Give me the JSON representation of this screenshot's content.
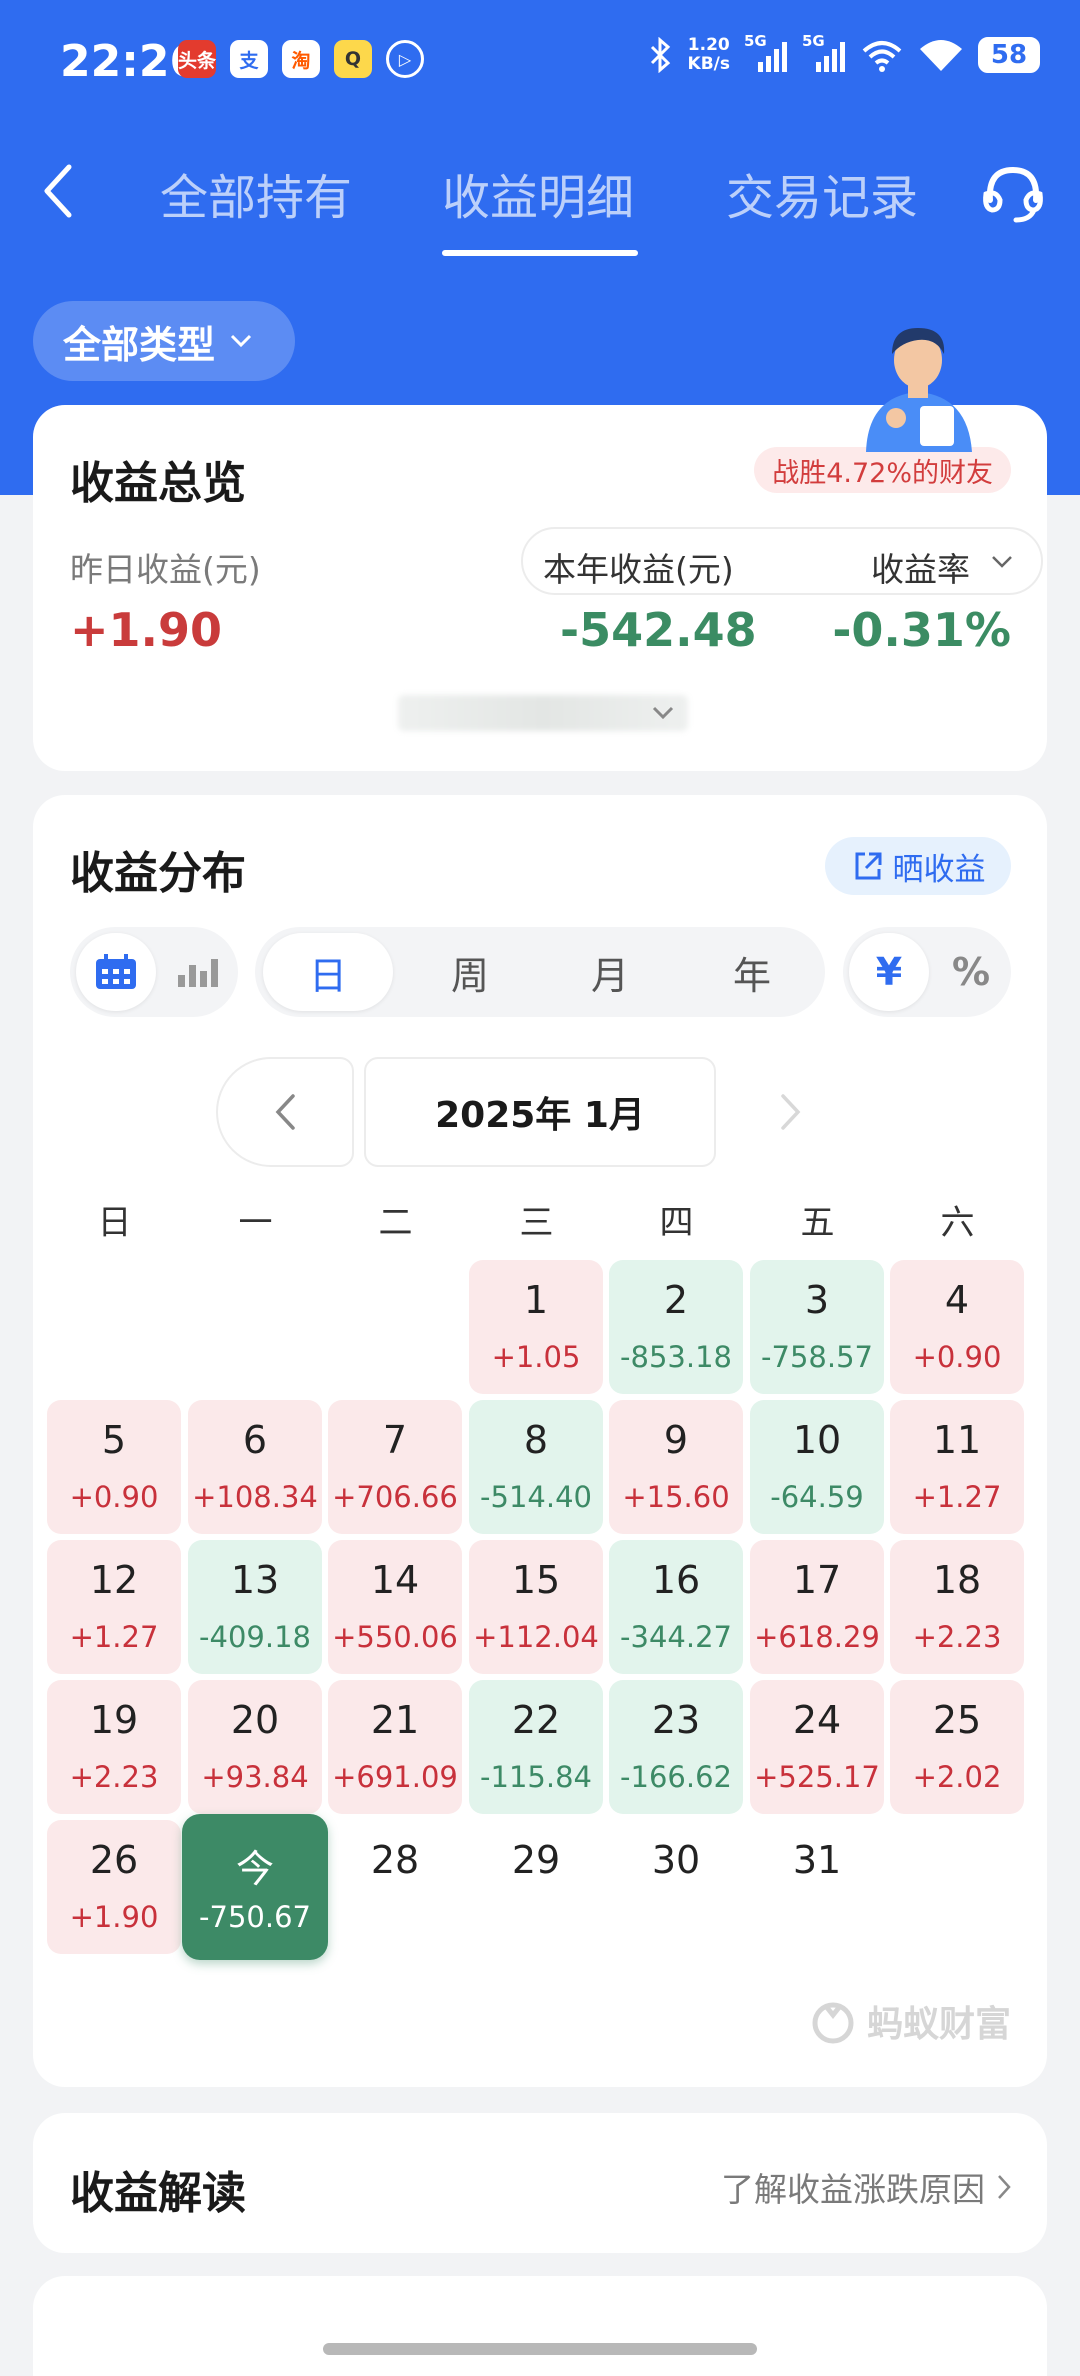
{
  "status_bar": {
    "time": "22:26",
    "app_icons": [
      {
        "name": "toutiao-app-icon",
        "label": "头条",
        "bg": "#e33b2e",
        "fg": "#ffffff"
      },
      {
        "name": "alipay-app-icon",
        "label": "支",
        "bg": "#ffffff",
        "fg": "#2f6cf0"
      },
      {
        "name": "taobao-app-icon",
        "label": "淘",
        "bg": "#ffffff",
        "fg": "#ff5a00"
      },
      {
        "name": "qq-app-icon",
        "label": "Q",
        "bg": "#fdd84b",
        "fg": "#333333"
      },
      {
        "name": "play-app-icon",
        "label": "▷",
        "bg": "transparent",
        "fg": "#ffffff"
      }
    ],
    "net_speed_value": "1.20",
    "net_speed_unit": "KB/s",
    "signal_1_label": "5G",
    "signal_2_label": "5G",
    "battery": "58"
  },
  "nav": {
    "tabs": [
      {
        "label": "全部持有",
        "active": false
      },
      {
        "label": "收益明细",
        "active": true
      },
      {
        "label": "交易记录",
        "active": false
      }
    ]
  },
  "filter": {
    "label": "全部类型"
  },
  "overview": {
    "title": "收益总览",
    "rank_badge": "战胜4.72%的财友",
    "yesterday_label": "昨日收益(元)",
    "yesterday_value": "+1.90",
    "year_label": "本年收益(元)",
    "year_value": "-542.48",
    "rate_label": "收益率",
    "rate_value": "-0.31%"
  },
  "distribution": {
    "title": "收益分布",
    "share_label": "晒收益",
    "period_tabs": [
      "日",
      "周",
      "月",
      "年"
    ],
    "active_period": "日",
    "unit_toggle": [
      "¥",
      "%"
    ],
    "active_unit": "¥",
    "view_toggle": [
      "calendar",
      "bar-chart"
    ],
    "active_view": "calendar",
    "month_label": "2025年 1月",
    "weekdays": [
      "日",
      "一",
      "二",
      "三",
      "四",
      "五",
      "六"
    ],
    "first_weekday_index": 3,
    "days": [
      {
        "day": "1",
        "value": "+1.05",
        "trend": "pos"
      },
      {
        "day": "2",
        "value": "-853.18",
        "trend": "neg"
      },
      {
        "day": "3",
        "value": "-758.57",
        "trend": "neg"
      },
      {
        "day": "4",
        "value": "+0.90",
        "trend": "pos"
      },
      {
        "day": "5",
        "value": "+0.90",
        "trend": "pos"
      },
      {
        "day": "6",
        "value": "+108.34",
        "trend": "pos"
      },
      {
        "day": "7",
        "value": "+706.66",
        "trend": "pos"
      },
      {
        "day": "8",
        "value": "-514.40",
        "trend": "neg"
      },
      {
        "day": "9",
        "value": "+15.60",
        "trend": "pos"
      },
      {
        "day": "10",
        "value": "-64.59",
        "trend": "neg"
      },
      {
        "day": "11",
        "value": "+1.27",
        "trend": "pos"
      },
      {
        "day": "12",
        "value": "+1.27",
        "trend": "pos"
      },
      {
        "day": "13",
        "value": "-409.18",
        "trend": "neg"
      },
      {
        "day": "14",
        "value": "+550.06",
        "trend": "pos"
      },
      {
        "day": "15",
        "value": "+112.04",
        "trend": "pos"
      },
      {
        "day": "16",
        "value": "-344.27",
        "trend": "neg"
      },
      {
        "day": "17",
        "value": "+618.29",
        "trend": "pos"
      },
      {
        "day": "18",
        "value": "+2.23",
        "trend": "pos"
      },
      {
        "day": "19",
        "value": "+2.23",
        "trend": "pos"
      },
      {
        "day": "20",
        "value": "+93.84",
        "trend": "pos"
      },
      {
        "day": "21",
        "value": "+691.09",
        "trend": "pos"
      },
      {
        "day": "22",
        "value": "-115.84",
        "trend": "neg"
      },
      {
        "day": "23",
        "value": "-166.62",
        "trend": "neg"
      },
      {
        "day": "24",
        "value": "+525.17",
        "trend": "pos"
      },
      {
        "day": "25",
        "value": "+2.02",
        "trend": "pos"
      },
      {
        "day": "26",
        "value": "+1.90",
        "trend": "pos"
      },
      {
        "day": "今",
        "value": "-750.67",
        "trend": "today"
      },
      {
        "day": "28",
        "value": "",
        "trend": "none"
      },
      {
        "day": "29",
        "value": "",
        "trend": "none"
      },
      {
        "day": "30",
        "value": "",
        "trend": "none"
      },
      {
        "day": "31",
        "value": "",
        "trend": "none"
      }
    ],
    "watermark": "蚂蚁财富"
  },
  "interpretation": {
    "title": "收益解读",
    "link": "了解收益涨跌原因"
  },
  "colors": {
    "brand_blue": "#2f6cf0",
    "gain_red": "#c8313b",
    "loss_green": "#3d8a66"
  }
}
